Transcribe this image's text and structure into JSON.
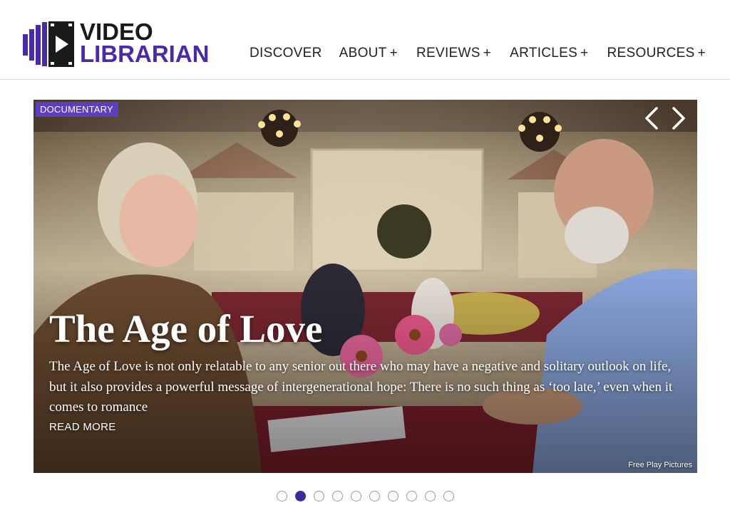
{
  "brand": {
    "logo_line1": "VIDEO",
    "logo_line2": "LIBRARIAN",
    "logo_icon": "film-strip-play-icon",
    "colors": {
      "purple": "#4b2aa8",
      "dark": "#1a1a1a"
    }
  },
  "nav": {
    "items": [
      {
        "label": "DISCOVER",
        "plus": ""
      },
      {
        "label": "ABOUT",
        "plus": "+"
      },
      {
        "label": "REVIEWS",
        "plus": "+"
      },
      {
        "label": "ARTICLES",
        "plus": "+"
      },
      {
        "label": "RESOURCES",
        "plus": "+"
      }
    ]
  },
  "slide": {
    "category": "DOCUMENTARY",
    "title": "The Age of Love",
    "excerpt": "The Age of Love is not only relatable to any senior out there who may have a negative and solitary outlook on life, but it also provides a powerful message of intergenerational hope: There is no such thing as ‘too late,’ even when it comes to romance",
    "read_more": "READ MORE",
    "credit": "Free Play Pictures",
    "prev_icon": "chevron-left-icon",
    "next_icon": "chevron-right-icon"
  },
  "pagination": {
    "total": 10,
    "active_index": 1
  }
}
